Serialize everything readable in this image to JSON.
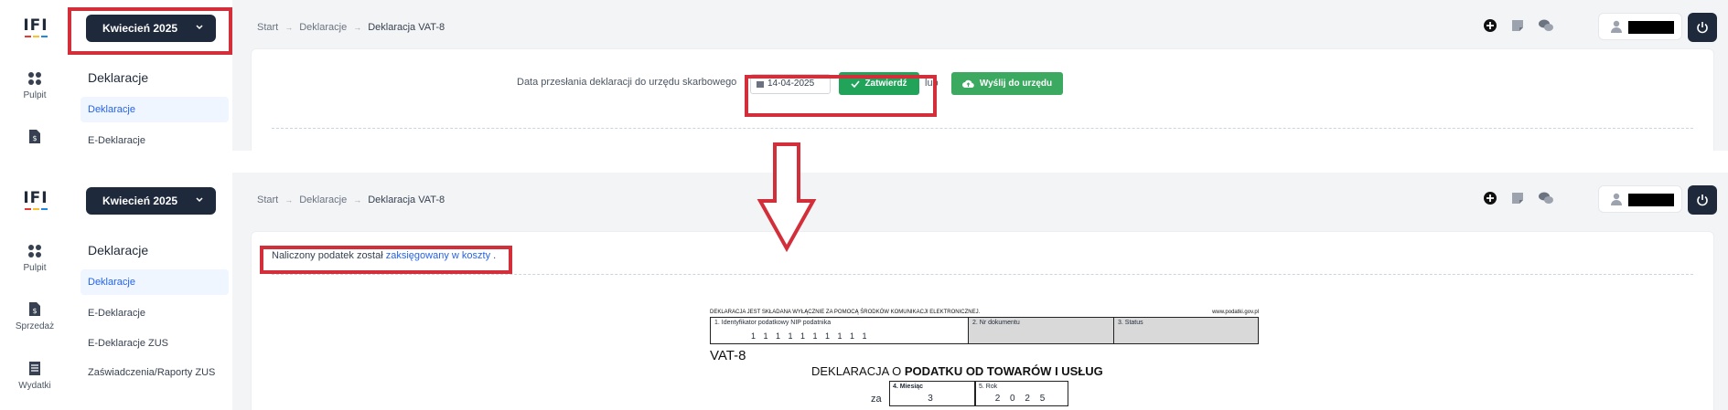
{
  "month_selector": "Kwiecień 2025",
  "rail": {
    "items": [
      {
        "label": "Pulpit",
        "icon": "dashboard-icon"
      },
      {
        "label": "Sprzedaż",
        "icon": "sales-doc-icon"
      },
      {
        "label": "Wydatki",
        "icon": "expenses-doc-icon"
      }
    ]
  },
  "subnav": {
    "title": "Deklaracje",
    "items": [
      "Deklaracje",
      "E-Deklaracje",
      "E-Deklaracje ZUS",
      "Zaświadczenia/Raporty ZUS"
    ]
  },
  "breadcrumb": [
    "Start",
    "Deklaracje",
    "Deklaracja VAT-8"
  ],
  "breadcrumb_sep": "→",
  "top_panel": {
    "send_label": "Data przesłania deklaracji do urzędu skarbowego",
    "date_value": "14-04-2025",
    "confirm_button": "Zatwierdź",
    "or_text": "lub",
    "send_button": "Wyślij do urzędu"
  },
  "bottom_panel": {
    "notice_prefix": "Naliczony podatek został",
    "notice_link": "zaksięgowany w koszty",
    "notice_suffix": "."
  },
  "form": {
    "header_left": "DEKLARACJA JEST SKŁADANA WYŁĄCZNIE ZA POMOCĄ ŚRODKÓW KOMUNIKACJI ELEKTRONICZNEJ.",
    "header_right": "www.podatki.gov.pl",
    "nip_label": "1. Identyfikator podatkowy NIP podatnika",
    "nip_value": "1 1 1 1 1 1 1 1 1 1",
    "doc_no_label": "2. Nr dokumentu",
    "status_label": "3. Status",
    "code": "VAT-8",
    "title_prefix": "DEKLARACJA O",
    "title_bold": "PODATKU OD TOWARÓW I USŁUG",
    "za": "za",
    "month_label": "4. Miesiąc",
    "month_value": "3",
    "year_label": "5. Rok",
    "year_value": "2 0 2 5"
  },
  "colors": {
    "accent_dark": "#1e293b",
    "success": "#22a35a",
    "highlight": "#d32f3a",
    "link": "#2563eb"
  }
}
